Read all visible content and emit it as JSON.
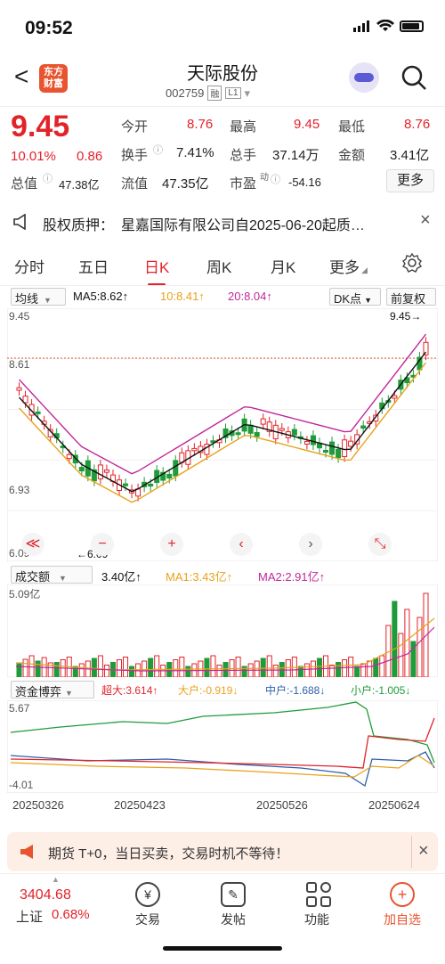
{
  "status": {
    "time": "09:52"
  },
  "header": {
    "back": "<",
    "logo_line1": "东方",
    "logo_line2": "财富",
    "title": "天际股份",
    "code": "002759",
    "tag1": "融",
    "tag2": "L1",
    "dropdown": "▾"
  },
  "quote": {
    "price": "9.45",
    "pct": "10.01%",
    "change": "0.86",
    "open_label": "今开",
    "open": "8.76",
    "high_label": "最高",
    "high": "9.45",
    "low_label": "最低",
    "low": "8.76",
    "turnover_label": "换手",
    "turnover": "7.41%",
    "volume_label": "总手",
    "volume": "37.14万",
    "amount_label": "金额",
    "amount": "3.41亿",
    "mktcap_label": "总值",
    "mktcap": "47.38亿",
    "float_label": "流值",
    "float": "47.35亿",
    "pe_label": "市盈",
    "pe_sup": "动",
    "pe": "-54.16",
    "more": "更多"
  },
  "notice": {
    "label": "股权质押：",
    "text": "星嘉国际有限公司自2025-06-20起质…",
    "close": "×"
  },
  "tabs": [
    "分时",
    "五日",
    "日K",
    "周K",
    "月K",
    "更多"
  ],
  "tab_more_arrow": "◢",
  "kline_toolbar": {
    "indicator": "均线",
    "ma5": "MA5:8.62↑",
    "ma10": "10:8.41↑",
    "ma20": "20:8.04↑",
    "dk": "DK点",
    "fq": "前复权"
  },
  "kline_axis": {
    "top": "9.45",
    "mid": "8.61",
    "low": "6.93",
    "bottom": "6.09",
    "last_label": "9.45→",
    "min_label": "←6.09"
  },
  "controls": [
    "≪",
    "−",
    "+",
    "‹",
    "›",
    "⤡"
  ],
  "volume_bar": {
    "label": "成交额",
    "value": "3.40亿↑",
    "ma1": "MA1:3.43亿↑",
    "ma2": "MA2:2.91亿↑",
    "top": "5.09亿"
  },
  "capital_bar": {
    "label": "资金博弈",
    "super": "超大:3.614↑",
    "big": "大户:-0.919↓",
    "mid": "中户:-1.688↓",
    "small": "小户:-1.005↓",
    "top": "5.67",
    "bottom": "-4.01"
  },
  "dates": [
    "20250326",
    "20250423",
    "20250526",
    "20250624"
  ],
  "banner": {
    "text": "期货 T+0，当日买卖，交易时机不等待！",
    "close": "×"
  },
  "bottom_nav": {
    "index_value": "3404.68",
    "index_name": "上证",
    "index_pct": "0.68%",
    "trade": "交易",
    "post": "发帖",
    "func": "功能",
    "add": "加自选"
  },
  "colors": {
    "up": "#e2232a",
    "down": "#1f9b3a",
    "ma5": "#111111",
    "ma10": "#e8a21b",
    "ma20": "#c0289b"
  }
}
